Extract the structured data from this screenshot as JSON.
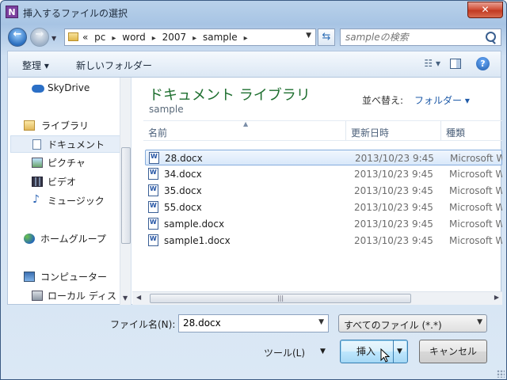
{
  "window": {
    "title": "挿入するファイルの選択",
    "app_icon_letter": "N",
    "close_glyph": "✕"
  },
  "address": {
    "crumbs": [
      "«",
      "pc",
      "word",
      "2007",
      "sample"
    ],
    "search_placeholder": "sampleの検索"
  },
  "toolbar": {
    "organize": "整理 ▾",
    "new_folder": "新しいフォルダー",
    "view_glyph": "☷ ▾",
    "help_glyph": "?"
  },
  "nav": {
    "items": [
      {
        "label": "SkyDrive"
      },
      {
        "label": "ライブラリ"
      },
      {
        "label": "ドキュメント"
      },
      {
        "label": "ピクチャ"
      },
      {
        "label": "ビデオ"
      },
      {
        "label": "ミュージック"
      },
      {
        "label": "ホームグループ"
      },
      {
        "label": "コンピューター"
      },
      {
        "label": "ローカル ディス"
      }
    ]
  },
  "library": {
    "title": "ドキュメント ライブラリ",
    "subtitle": "sample",
    "arrange_label": "並べ替え:",
    "arrange_value": "フォルダー ▾"
  },
  "columns": {
    "name": "名前",
    "date": "更新日時",
    "type": "種類"
  },
  "files": [
    {
      "name": "28.docx",
      "date": "2013/10/23 9:45",
      "type": "Microsoft W"
    },
    {
      "name": "34.docx",
      "date": "2013/10/23 9:45",
      "type": "Microsoft W"
    },
    {
      "name": "35.docx",
      "date": "2013/10/23 9:45",
      "type": "Microsoft W"
    },
    {
      "name": "55.docx",
      "date": "2013/10/23 9:45",
      "type": "Microsoft W"
    },
    {
      "name": "sample.docx",
      "date": "2013/10/23 9:45",
      "type": "Microsoft W"
    },
    {
      "name": "sample1.docx",
      "date": "2013/10/23 9:45",
      "type": "Microsoft W"
    }
  ],
  "bottom": {
    "filename_label": "ファイル名(N):",
    "filename_value": "28.docx",
    "filter_value": "すべてのファイル (*.*)",
    "tools_label": "ツール(L)",
    "insert_label": "挿入",
    "cancel_label": "キャンセル"
  }
}
